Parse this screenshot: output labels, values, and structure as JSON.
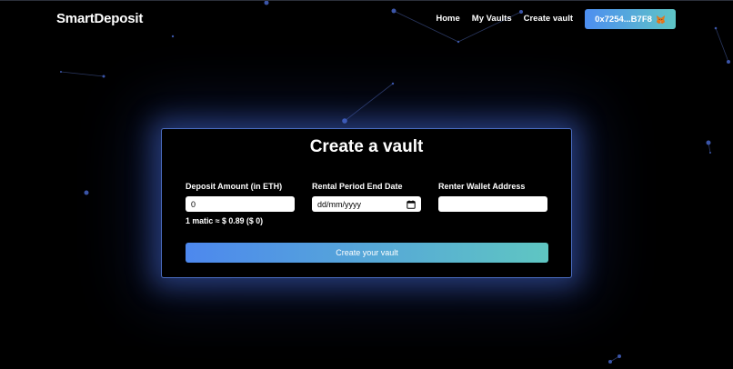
{
  "navbar": {
    "brand": "SmartDeposit",
    "links": [
      "Home",
      "My Vaults",
      "Create vault"
    ],
    "wallet_address": "0x7254...B7F8",
    "wallet_icon": "metamask-fox-icon"
  },
  "form": {
    "title": "Create a vault",
    "deposit_label": "Deposit Amount (in ETH)",
    "deposit_value": "0",
    "rental_end_label": "Rental Period End Date",
    "rental_end_placeholder": "dd/mm/yyyy",
    "renter_label": "Renter Wallet Address",
    "renter_value": "",
    "rate_text": "1 matic ≈ $ 0.89 ($ 0)",
    "submit_label": "Create your vault"
  },
  "colors": {
    "background": "#000000",
    "accent_start": "#4d88ee",
    "accent_end": "#5fc6c2",
    "card_glow": "#4a6cc0"
  }
}
